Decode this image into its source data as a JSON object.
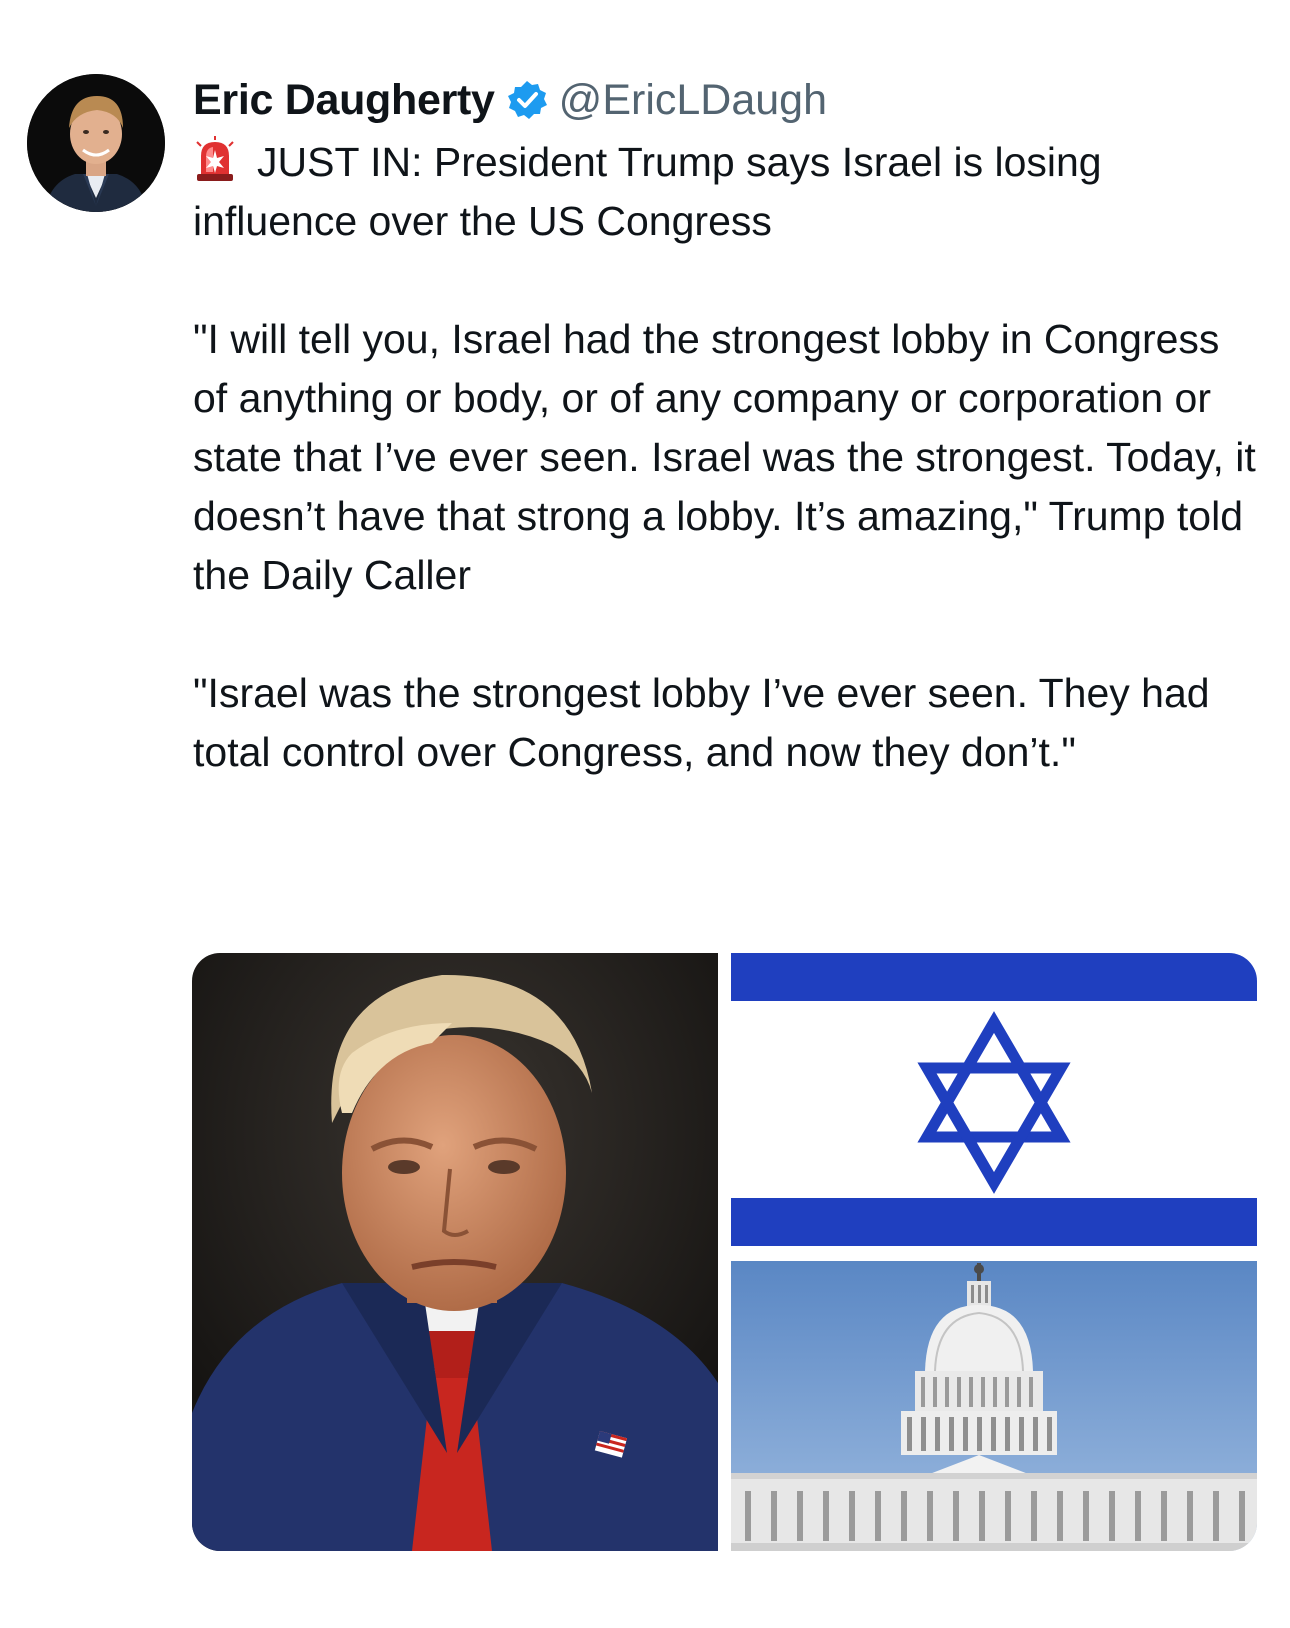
{
  "tweet": {
    "author": {
      "display_name": "Eric Daugherty",
      "handle": "@EricLDaugh",
      "verified": true,
      "verified_badge_color": "#1d9bf0"
    },
    "lead_icon": "siren-icon",
    "paragraphs": [
      "JUST IN: President Trump says Israel is losing influence over the US Congress",
      "\"I will tell you, Israel had the strongest lobby in Congress of anything or body, or of any company or corporation or state that I’ve ever seen. Israel was the strongest. Today, it doesn’t have that strong a lobby. It’s amazing,\" Trump told the Daily Caller",
      "\"Israel was the strongest lobby I’ve ever seen. They had total control over Congress, and now they don’t.\""
    ],
    "media": [
      {
        "subject": "portrait of Donald Trump"
      },
      {
        "subject": "flag of Israel",
        "colors": {
          "blue": "#1f3fbf",
          "white": "#ffffff"
        }
      },
      {
        "subject": "US Capitol building"
      }
    ],
    "colors": {
      "text": "#0f1419",
      "secondary_text": "#536471",
      "background": "#ffffff"
    }
  }
}
